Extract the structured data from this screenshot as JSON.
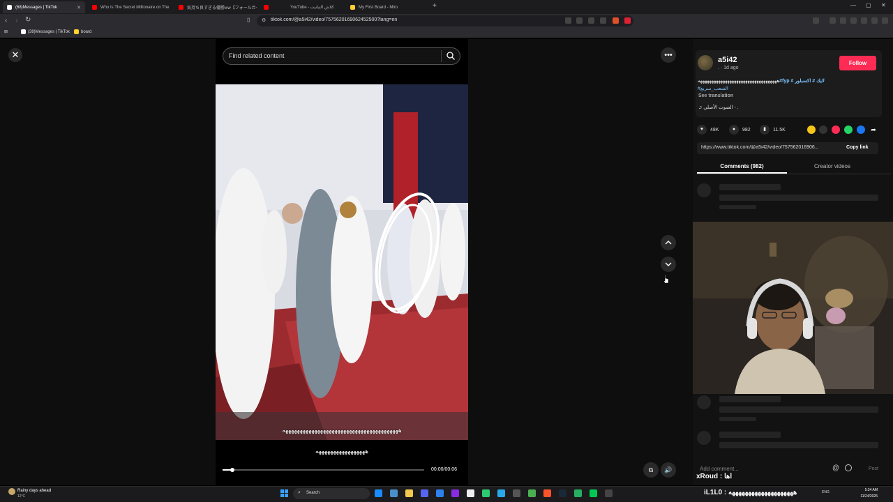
{
  "browser": {
    "tabs": [
      {
        "label": "(68)Messages | TikTok",
        "favicon_color": "#ffffff"
      },
      {
        "label": "Who Is The Secret Millionaire on The",
        "favicon_color": "#ff0000"
      },
      {
        "label": "気持ち良すぎる優勝ww【フォールガイズ/ら",
        "favicon_color": "#ff0000"
      },
      {
        "label": "",
        "favicon_color": "#ff0000"
      },
      {
        "label": "YouTube - كلاش التيانيت",
        "favicon_color": "#ff0000"
      },
      {
        "label": "My First Board - Miro",
        "favicon_color": "#ffd02f"
      }
    ],
    "new_tab_glyph": "+",
    "url": "tiktok.com/@a5i42/video/7575620169062452500?lang=en",
    "bookmarks": [
      {
        "label": "(38)Messages | TikTok"
      },
      {
        "label": "board"
      }
    ]
  },
  "search": {
    "placeholder": "Find related content"
  },
  "video": {
    "caption_line1": "ههههههههههههههههههههههههههههههههههههههههه",
    "caption_line2": "هههههههههههههههههه",
    "time": "00:00/00:06",
    "progress": 0.05
  },
  "post": {
    "username": "a5i42",
    "posted": ". · 1d ago",
    "follow_label": "Follow",
    "desc_text": "هههههههههههههههههههههههههههههههههههه",
    "desc_tags": "#fyp # لايك # اكسبلور",
    "desc_tags2": "#الشعب_سريع",
    "see_translation": "See translation",
    "sound": "♫  الصوت الأصلي - .",
    "likes": "48K",
    "comments": "982",
    "saves": "11.5K",
    "link": "https://www.tiktok.com/@a5i42/video/757562016906...",
    "copy_link": "Copy link"
  },
  "tabs": {
    "comments_label": "Comments (982)",
    "creator_label": "Creator videos"
  },
  "comment_box": {
    "placeholder": "Add comment...",
    "at": "@",
    "post_label": "Post"
  },
  "stream_chat": {
    "line1": "xRoud : اها"
  },
  "taskbar": {
    "weather_line1": "Rainy days ahead",
    "weather_line2": "12°C",
    "search_label": "Search",
    "ticker": "iL1L0 : ههههههههههههههههههههه",
    "tray_lang": "ENG",
    "clock_time": "5:34 AM",
    "clock_date": "11/24/2025"
  },
  "colors": {
    "follow": "#fe2c55",
    "hashtag": "#7cc4ff"
  }
}
